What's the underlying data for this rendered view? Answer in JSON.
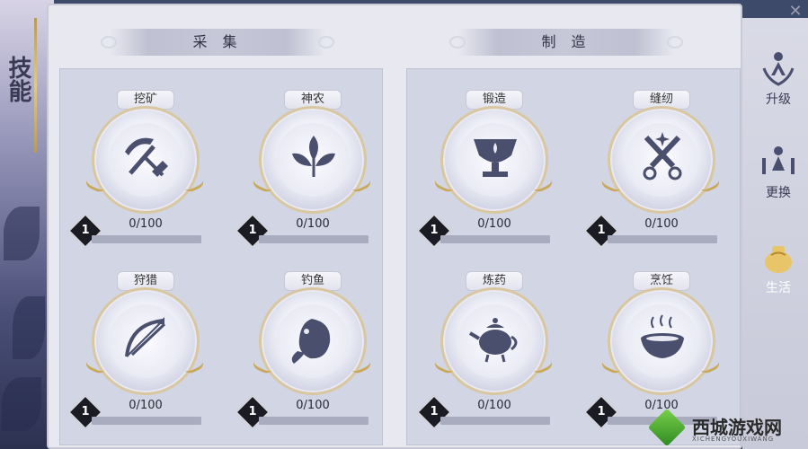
{
  "page": {
    "title": "技能"
  },
  "sections": {
    "gathering": {
      "title": "采 集"
    },
    "crafting": {
      "title": "制 造"
    }
  },
  "skills": [
    {
      "name": "挖矿",
      "level": "1",
      "progress": "0/100",
      "progress_fraction": 0,
      "icon": "pickaxe-shovel-icon"
    },
    {
      "name": "神农",
      "level": "1",
      "progress": "0/100",
      "progress_fraction": 0,
      "icon": "herb-leaf-icon"
    },
    {
      "name": "狩猎",
      "level": "1",
      "progress": "0/100",
      "progress_fraction": 0,
      "icon": "bow-arrow-icon"
    },
    {
      "name": "钓鱼",
      "level": "1",
      "progress": "0/100",
      "progress_fraction": 0,
      "icon": "fish-icon"
    },
    {
      "name": "锻造",
      "level": "1",
      "progress": "0/100",
      "progress_fraction": 0,
      "icon": "anvil-cup-icon"
    },
    {
      "name": "缝纫",
      "level": "1",
      "progress": "0/100",
      "progress_fraction": 0,
      "icon": "scissors-icon"
    },
    {
      "name": "炼药",
      "level": "1",
      "progress": "0/100",
      "progress_fraction": 0,
      "icon": "teapot-icon"
    },
    {
      "name": "烹饪",
      "level": "1",
      "progress": "0/100",
      "progress_fraction": 0,
      "icon": "cooking-pot-icon"
    }
  ],
  "side_tabs": [
    {
      "label": "升级",
      "icon": "upgrade-figure-icon",
      "active": false
    },
    {
      "label": "更换",
      "icon": "change-figure-icon",
      "active": false
    },
    {
      "label": "生活",
      "icon": "life-bag-icon",
      "active": true
    }
  ],
  "close": {
    "symbol": "✕"
  },
  "watermark": {
    "text": "西城游戏网",
    "sub": "XICHENGYOUXIWANG"
  },
  "colors": {
    "accent_gold": "#c9a85a",
    "panel": "#d2d5e3",
    "active_tab": "#2d3356"
  }
}
